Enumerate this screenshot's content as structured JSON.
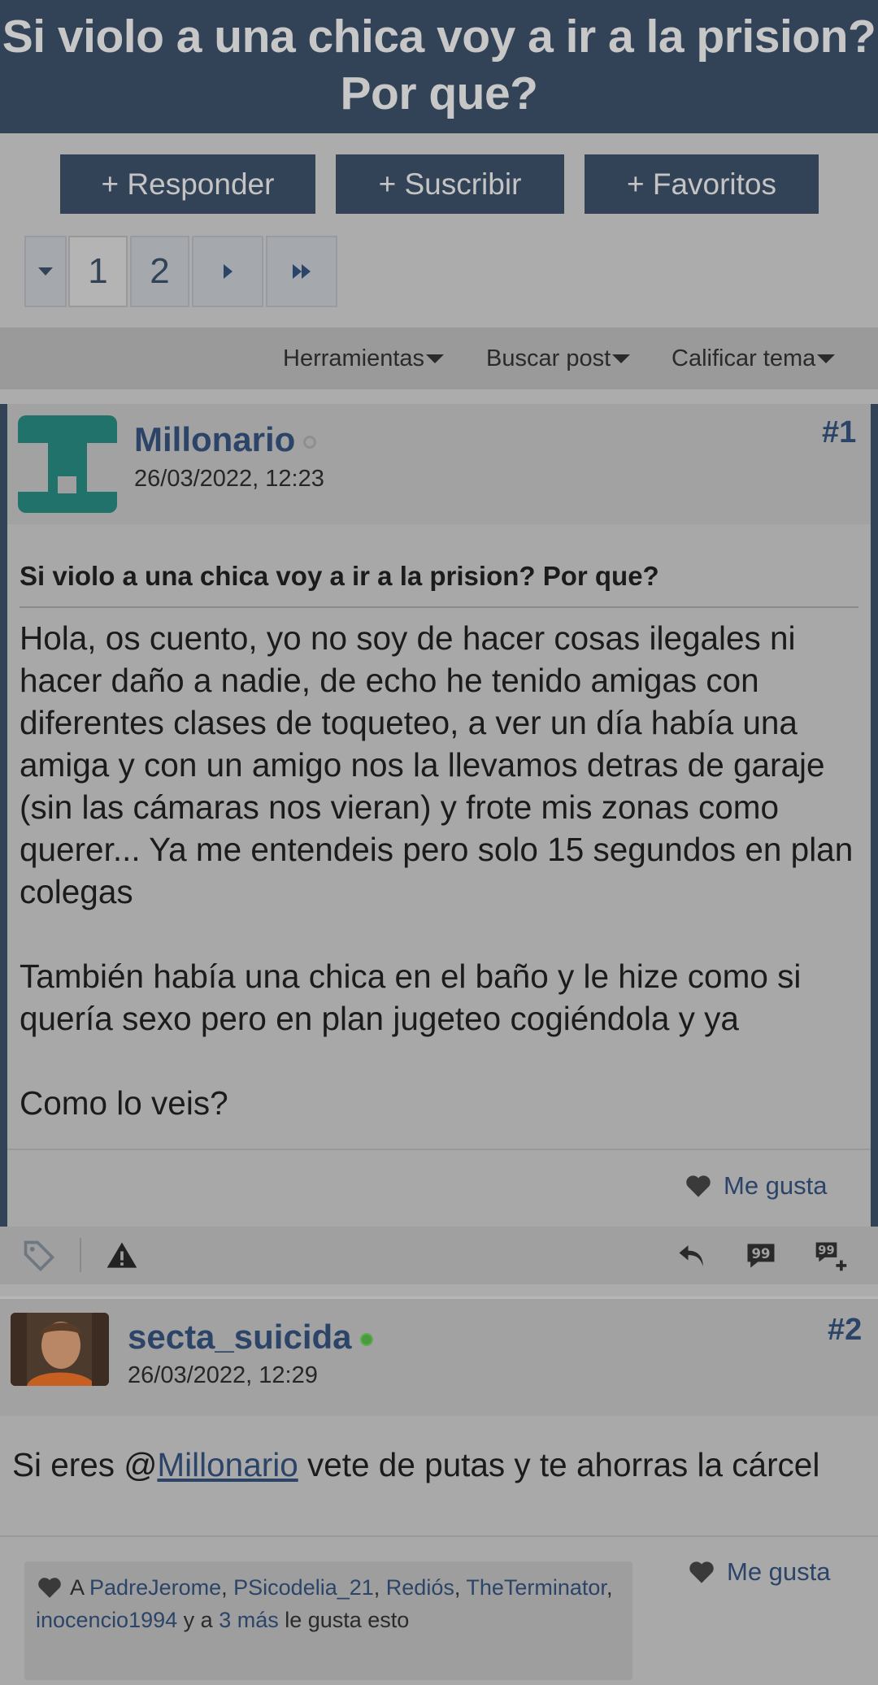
{
  "thread": {
    "title_line1": "Si violo a una chica voy a ir a la prision?",
    "title_line2": "Por que?"
  },
  "actions": {
    "reply": "+ Responder",
    "subscribe": "+ Suscribir",
    "favorites": "+ Favoritos"
  },
  "pagination": {
    "pages": [
      "1",
      "2"
    ],
    "current": "1"
  },
  "tools": {
    "tools_label": "Herramientas",
    "search_label": "Buscar post",
    "rate_label": "Calificar tema"
  },
  "posts": [
    {
      "username": "Millonario",
      "online": false,
      "date": "26/03/2022, 12:23",
      "number": "#1",
      "title": "Si violo a una chica voy a ir a la prision? Por que?",
      "body": "Hola, os cuento, yo no soy de hacer cosas ilegales ni hacer daño a nadie, de echo he tenido amigas con diferentes clases de toqueteo, a ver un día había una amiga y con un amigo nos la llevamos detras de garaje (sin las cámaras nos vieran) y frote mis zonas como querer... Ya me entendeis pero solo 15 segundos en plan colegas\n\nTambién había una chica en el baño y le hize como si quería sexo pero en plan jugeteo cogiéndola y ya\n\nComo lo veis?",
      "like_label": "Me gusta",
      "avatar_color": "#21726b"
    },
    {
      "username": "secta_suicida",
      "online": true,
      "date": "26/03/2022, 12:29",
      "number": "#2",
      "body_prefix": "Si eres @",
      "mention": "Millonario",
      "body_suffix": " vete de putas y te ahorras la cárcel",
      "like_label": "Me gusta",
      "likers": {
        "prefix": "A ",
        "names": [
          "PadreJerome",
          "PSicodelia_21",
          "Rediós",
          "TheTerminator",
          "inocencio1994"
        ],
        "and_text": " y a ",
        "more": "3 más",
        "suffix": " le gusta esto"
      }
    }
  ],
  "colors": {
    "header_bg": "#334357",
    "link": "#2b4468",
    "online": "#4a9a3f",
    "offline": "#8f8f8f"
  },
  "icons": {
    "tag": "tag-icon",
    "report": "warning-icon",
    "reply": "reply-arrow-icon",
    "quote": "quote-icon",
    "multiquote": "multi-quote-icon"
  }
}
